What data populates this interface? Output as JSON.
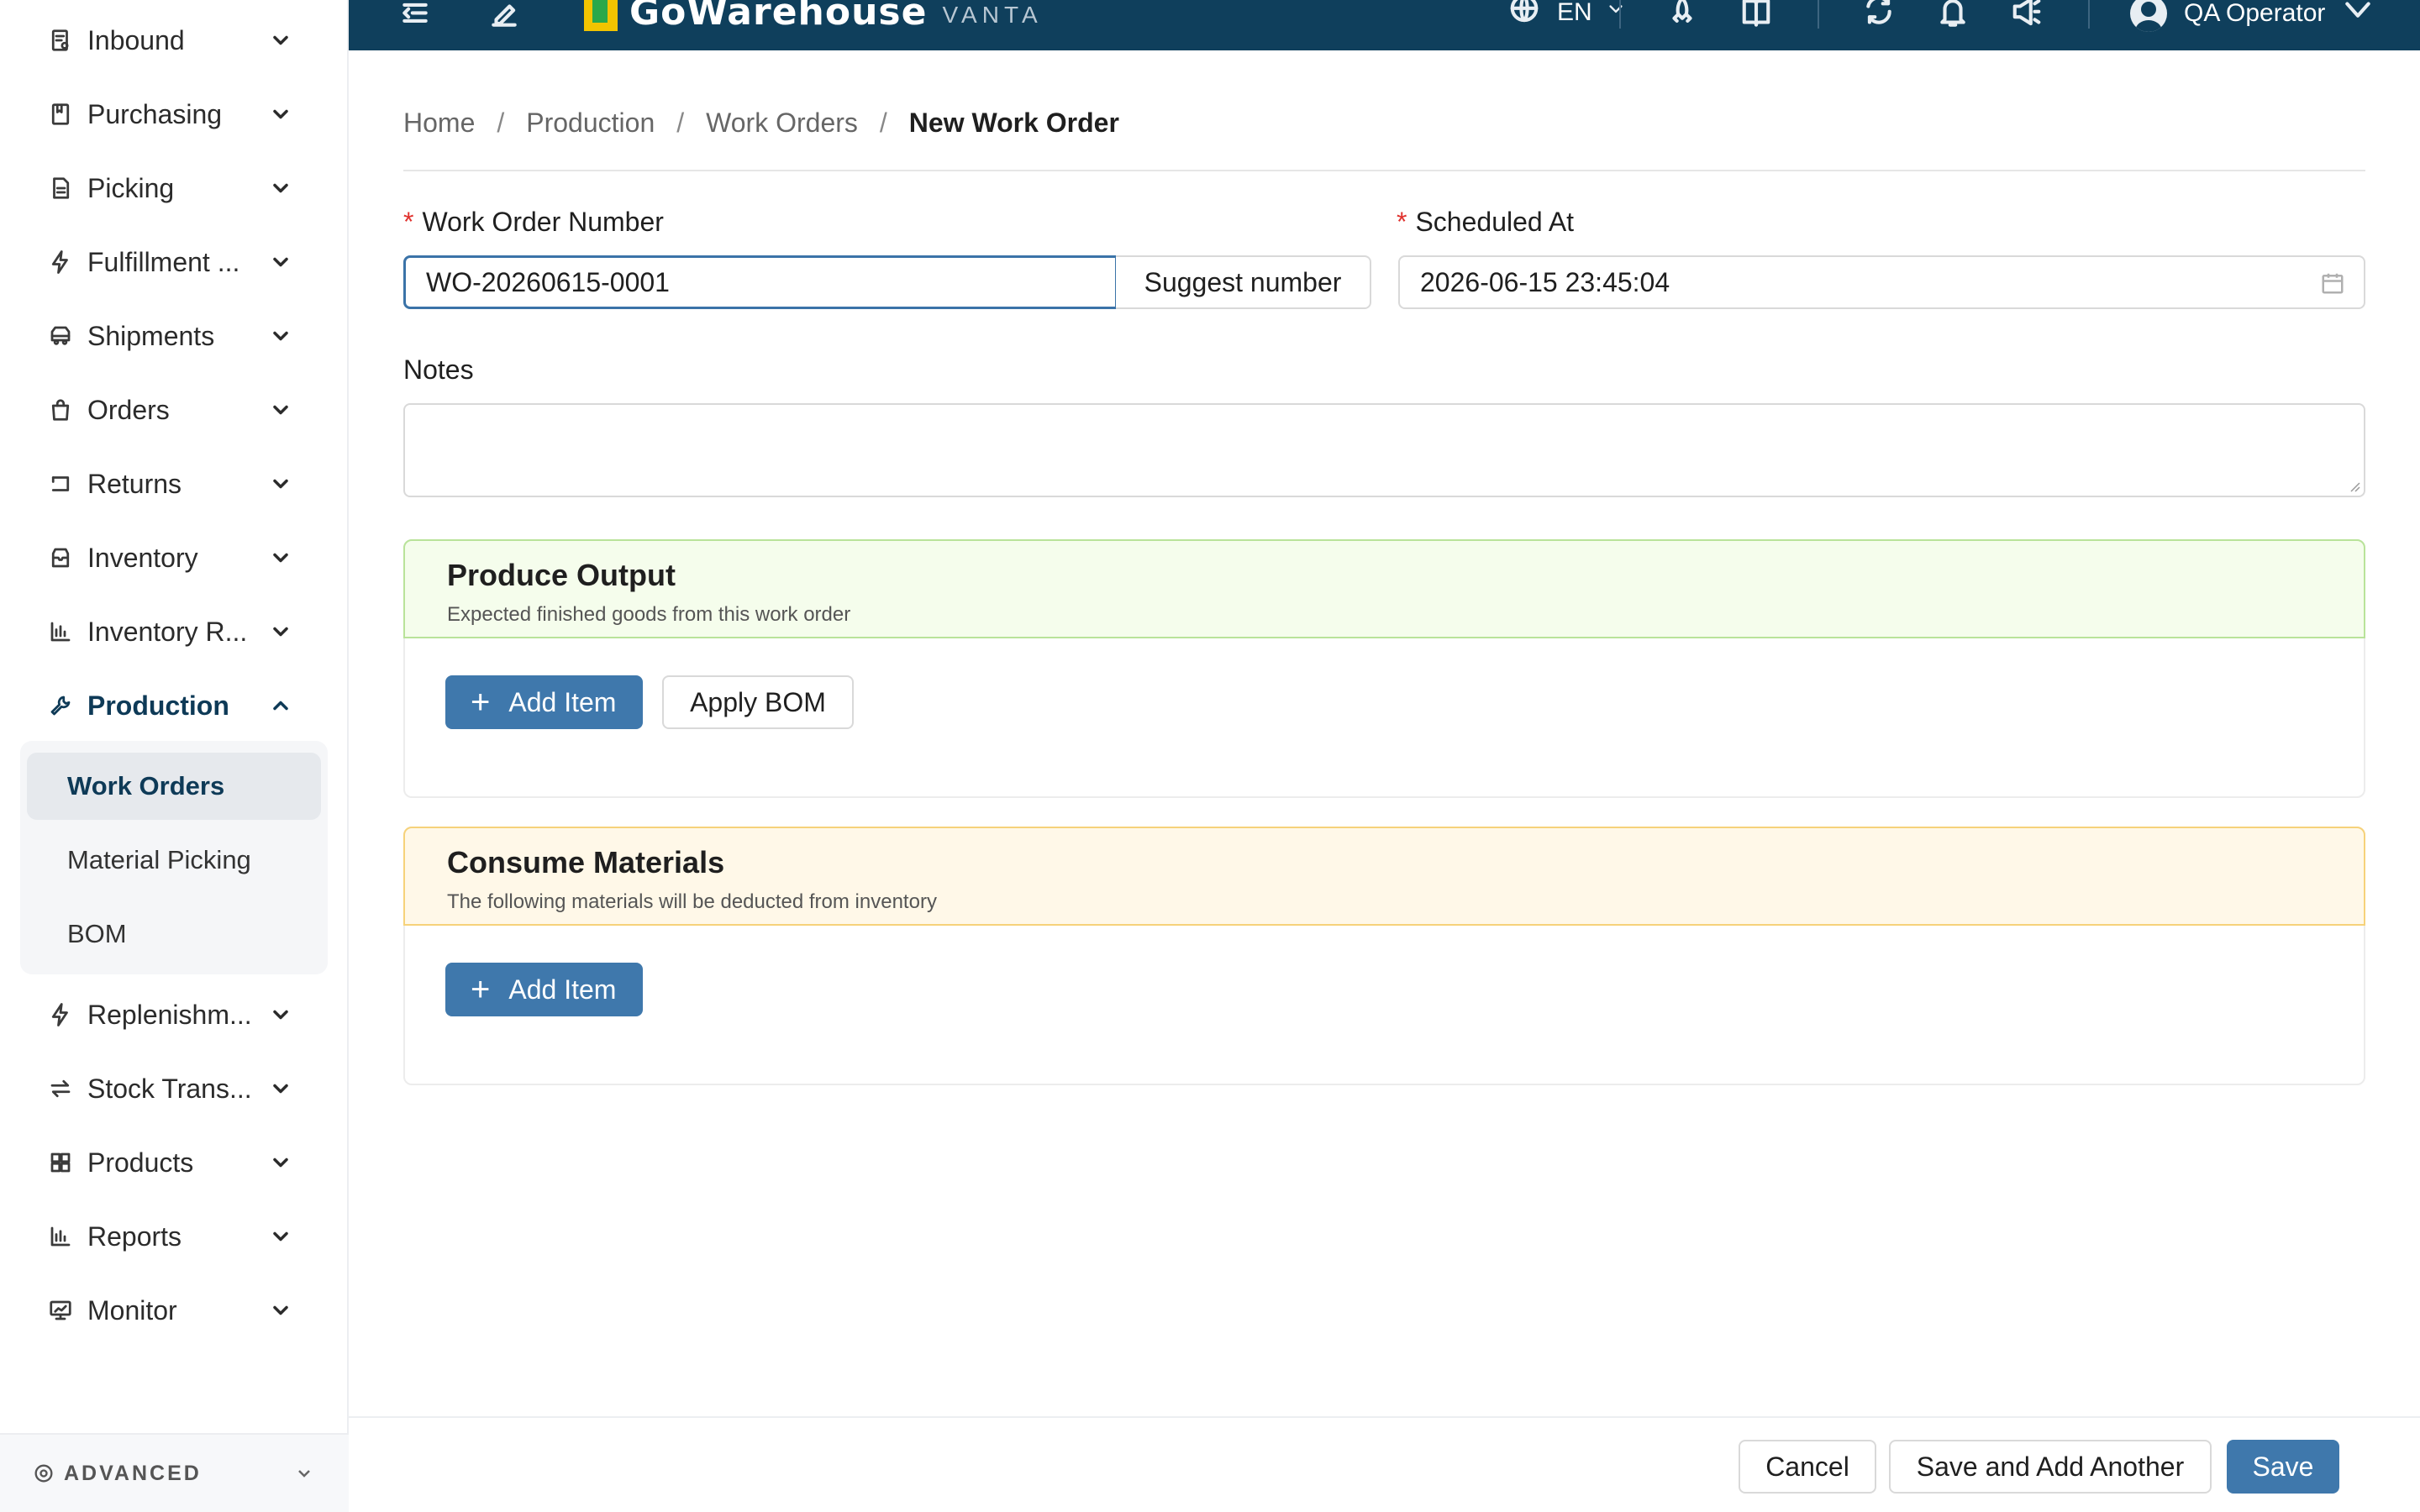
{
  "app": {
    "logo_text": "GoWarehouse",
    "logo_sub": "VANTA",
    "language": "EN",
    "user_name": "QA Operator"
  },
  "sidebar": {
    "items": [
      {
        "label": "Inbound",
        "icon": "inbound-icon"
      },
      {
        "label": "Purchasing",
        "icon": "purchasing-icon"
      },
      {
        "label": "Picking",
        "icon": "picking-icon"
      },
      {
        "label": "Fulfillment ...",
        "icon": "fulfillment-icon"
      },
      {
        "label": "Shipments",
        "icon": "shipments-icon"
      },
      {
        "label": "Orders",
        "icon": "orders-icon"
      },
      {
        "label": "Returns",
        "icon": "returns-icon"
      },
      {
        "label": "Inventory",
        "icon": "inventory-icon"
      },
      {
        "label": "Inventory R...",
        "icon": "inventory-report-icon"
      },
      {
        "label": "Production",
        "icon": "production-icon",
        "expanded": true
      },
      {
        "label": "Replenishm...",
        "icon": "replenishment-icon"
      },
      {
        "label": "Stock Trans...",
        "icon": "stock-transfer-icon"
      },
      {
        "label": "Products",
        "icon": "products-icon"
      },
      {
        "label": "Reports",
        "icon": "reports-icon"
      },
      {
        "label": "Monitor",
        "icon": "monitor-icon"
      }
    ],
    "production_sub": [
      {
        "label": "Work Orders",
        "selected": true
      },
      {
        "label": "Material Picking"
      },
      {
        "label": "BOM"
      }
    ],
    "advanced_label": "ADVANCED"
  },
  "breadcrumb": [
    "Home",
    "Production",
    "Work Orders",
    "New Work Order"
  ],
  "form": {
    "work_order_label": "Work Order Number",
    "work_order_value": "WO-20260615-0001",
    "suggest_label": "Suggest number",
    "scheduled_label": "Scheduled At",
    "scheduled_value": "2026-06-15 23:45:04",
    "notes_label": "Notes",
    "notes_value": ""
  },
  "produce": {
    "title": "Produce Output",
    "subtitle": "Expected finished goods from this work order",
    "add_item": "Add Item",
    "apply_bom": "Apply BOM"
  },
  "consume": {
    "title": "Consume Materials",
    "subtitle": "The following materials will be deducted from inventory",
    "add_item": "Add Item"
  },
  "footer": {
    "cancel": "Cancel",
    "save_another": "Save and Add Another",
    "save": "Save"
  },
  "colors": {
    "header_bg": "#0f3f5c",
    "primary": "#3f78ac",
    "produce_bg": "#f5fdec",
    "consume_bg": "#fff8e8",
    "required": "#e0322e"
  }
}
